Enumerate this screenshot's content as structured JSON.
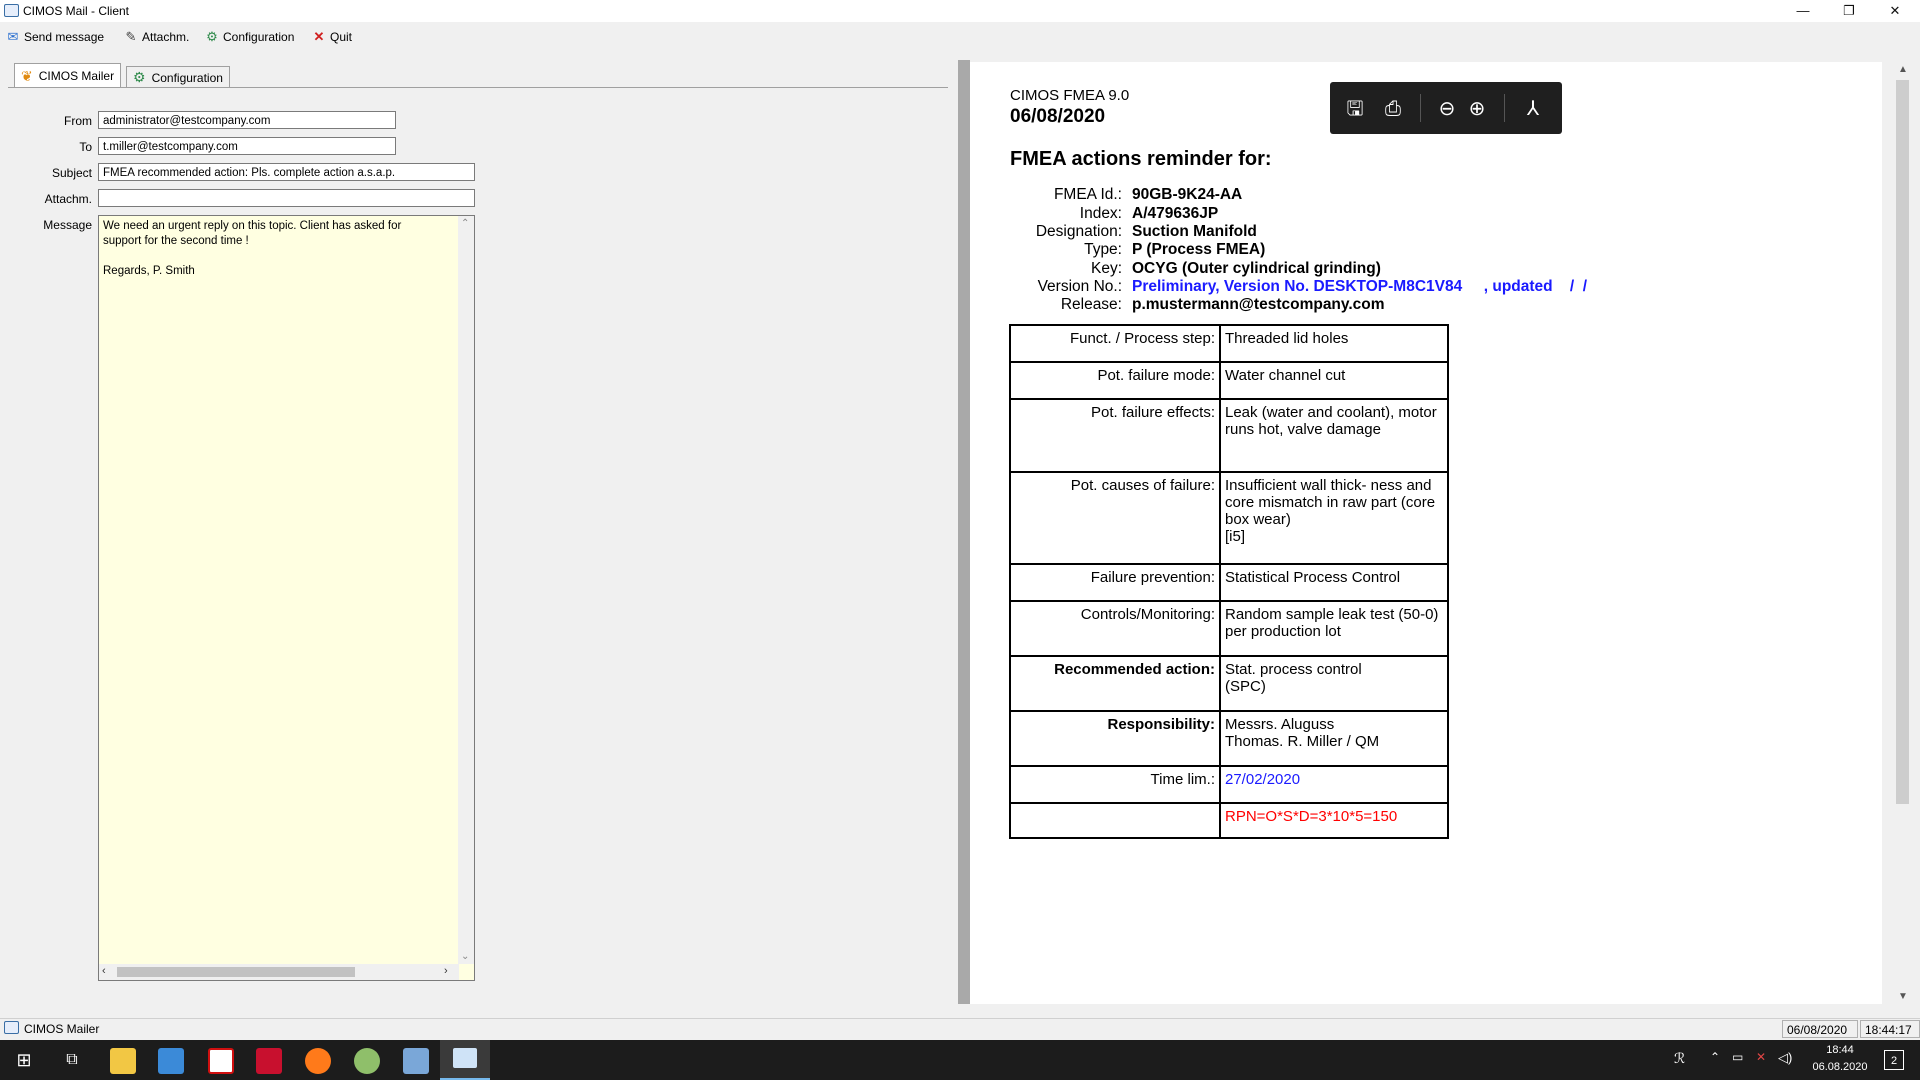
{
  "window": {
    "title": "CIMOS Mail - Client",
    "min_glyph": "—",
    "restore_glyph": "❐",
    "close_glyph": "✕"
  },
  "toolbar": {
    "send_label": "Send message",
    "attach_label": "Attachm.",
    "config_label": "Configuration",
    "quit_label": "Quit"
  },
  "tabs": {
    "mailer": "CIMOS Mailer",
    "config": "Configuration"
  },
  "form": {
    "from_label": "From",
    "from_value": "administrator@testcompany.com",
    "to_label": "To",
    "to_value": "t.miller@testcompany.com",
    "subject_label": "Subject",
    "subject_value": "FMEA recommended action: Pls. complete action a.s.a.p.",
    "attach_label": "Attachm.",
    "attach_value": "",
    "message_label": "Message",
    "message_value": "We need an urgent reply on this topic. Client has asked for\nsupport for the second time !\n\nRegards, P. Smith"
  },
  "doc": {
    "product": "CIMOS FMEA 9.0",
    "date": "06/08/2020",
    "heading": "FMEA actions reminder for:",
    "fields": [
      {
        "label": "FMEA Id.:",
        "value": "90GB-9K24-AA"
      },
      {
        "label": "Index:",
        "value": "A/479636JP"
      },
      {
        "label": "Designation:",
        "value": "Suction Manifold"
      },
      {
        "label": "Type:",
        "value": "P (Process FMEA)"
      },
      {
        "label": "Key:",
        "value": "OCYG (Outer cylindrical grinding)"
      },
      {
        "label": "Version No.:",
        "value": "Preliminary, Version No. DESKTOP-M8C1V84     , updated    /  /"
      },
      {
        "label": "Release:",
        "value": "p.mustermann@testcompany.com"
      }
    ],
    "table": [
      {
        "label": "Funct. / Process step:",
        "value": "Threaded lid holes"
      },
      {
        "label": "Pot. failure mode:",
        "value": "Water channel cut"
      },
      {
        "label": "Pot. failure effects:",
        "value": "Leak (water and coolant), motor runs hot, valve damage"
      },
      {
        "label": "Pot. causes of failure:",
        "value": "Insufficient wall thick- ness and core mismatch in raw part (core box wear)\n[i5]"
      },
      {
        "label": "Failure prevention:",
        "value": "Statistical Process Control"
      },
      {
        "label": "Controls/Monitoring:",
        "value": "Random sample leak test (50-0) per production lot"
      },
      {
        "label": "Recommended action:",
        "value": "Stat. process control\n(SPC)"
      },
      {
        "label": "Responsibility:",
        "value": "Messrs. Aluguss\nThomas. R. Miller / QM"
      },
      {
        "label": "Time lim.:",
        "value": "27/02/2020"
      },
      {
        "label": "",
        "value": "RPN=O*S*D=3*10*5=150"
      }
    ],
    "link_color": "#1a1aff",
    "rpn_color": "#ff0000"
  },
  "statusbar": {
    "app_label": "CIMOS Mailer",
    "date": "06/08/2020",
    "time": "18:44:17"
  },
  "taskbar": {
    "clock_time": "18:44",
    "clock_date": "06.08.2020",
    "notif_count": "2",
    "icons": [
      "windows-start-icon",
      "task-view-icon",
      "file-explorer-icon",
      "control-panel-icon",
      "antivirus-icon",
      "acrobat-icon",
      "firefox-icon",
      "paint-icon",
      "notepad-icon",
      "cimos-mail-icon"
    ]
  }
}
